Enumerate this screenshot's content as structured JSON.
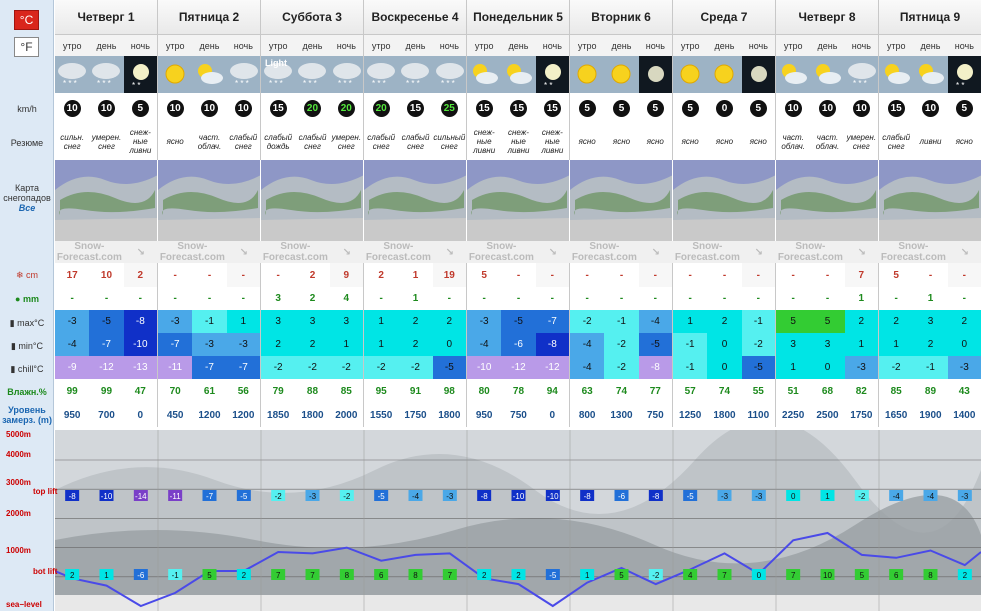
{
  "units": {
    "celsius": "°C",
    "fahrenheit": "°F"
  },
  "labels": {
    "wind": "km/h",
    "summary": "Резюме",
    "snow_map": "Карта снегопадов",
    "snow_map_all": "Все",
    "snow": "cm",
    "rain": "mm",
    "max": "max°C",
    "min": "min°C",
    "chill": "chill°C",
    "humidity": "Влажн.%",
    "freeze": "Уровень замерз. (m)",
    "alt_5000": "5000m",
    "alt_4000": "4000m",
    "alt_3000": "3000m",
    "alt_2000": "2000m",
    "alt_1000": "1000m",
    "sea_level": "sea−level",
    "top_lift": "top lift",
    "bot_lift": "bot lift",
    "logo": "Snow-Forecast.com"
  },
  "days": [
    {
      "name": "Четверг 1",
      "periods": 3
    },
    {
      "name": "Пятница 2",
      "periods": 3
    },
    {
      "name": "Суббота 3",
      "periods": 3
    },
    {
      "name": "Воскресенье 4",
      "periods": 3
    },
    {
      "name": "Понедельник 5",
      "periods": 3
    },
    {
      "name": "Вторник 6",
      "periods": 3
    },
    {
      "name": "Среда 7",
      "periods": 3
    },
    {
      "name": "Четверг 8",
      "periods": 3
    },
    {
      "name": "Пятница 9",
      "periods": 3
    }
  ],
  "periods": [
    "утро",
    "день",
    "ночь",
    "утро",
    "день",
    "ночь",
    "утро",
    "день",
    "ночь",
    "утро",
    "день",
    "ночь",
    "утро",
    "день",
    "ночь",
    "утро",
    "день",
    "ночь",
    "утро",
    "день",
    "ночь",
    "утро",
    "день",
    "ночь",
    "утро",
    "день",
    "ночь"
  ],
  "icon_caption": "Light",
  "wind": [
    "10",
    "10",
    "5",
    "10",
    "10",
    "10",
    "15",
    "20",
    "20",
    "20",
    "15",
    "25",
    "15",
    "15",
    "15",
    "5",
    "5",
    "5",
    "5",
    "0",
    "5",
    "10",
    "10",
    "10",
    "15",
    "10",
    "5"
  ],
  "wind_green": [
    false,
    false,
    false,
    false,
    false,
    false,
    false,
    true,
    true,
    true,
    false,
    true,
    false,
    false,
    false,
    false,
    false,
    false,
    false,
    false,
    false,
    false,
    false,
    false,
    false,
    false,
    false
  ],
  "summary": [
    "сильн. снег",
    "умерен. снег",
    "снеж-ные ливни",
    "ясно",
    "част. облач.",
    "слабый снег",
    "слабый дождь",
    "слабый снег",
    "умерен. снег",
    "слабый снег",
    "слабый снег",
    "сильный снег",
    "снеж-ные ливни",
    "снеж-ные ливни",
    "снеж-ные ливни",
    "ясно",
    "ясно",
    "ясно",
    "ясно",
    "ясно",
    "ясно",
    "част. облач.",
    "част. облач.",
    "умерен. снег",
    "слабый снег",
    "ливни",
    "ясно"
  ],
  "snow": [
    "17",
    "10",
    "2",
    "-",
    "-",
    "-",
    "-",
    "2",
    "9",
    "2",
    "1",
    "19",
    "5",
    "-",
    "-",
    "-",
    "-",
    "-",
    "-",
    "-",
    "-",
    "-",
    "-",
    "7",
    "5",
    "-",
    "-"
  ],
  "rain": [
    "-",
    "-",
    "-",
    "-",
    "-",
    "-",
    "3",
    "2",
    "4",
    "-",
    "1",
    "-",
    "-",
    "-",
    "-",
    "-",
    "-",
    "-",
    "-",
    "-",
    "-",
    "-",
    "-",
    "1",
    "-",
    "1",
    "-"
  ],
  "max": [
    "-3",
    "-5",
    "-8",
    "-3",
    "-1",
    "1",
    "3",
    "3",
    "3",
    "1",
    "2",
    "2",
    "-3",
    "-5",
    "-7",
    "-2",
    "-1",
    "-4",
    "1",
    "2",
    "-1",
    "5",
    "5",
    "2",
    "2",
    "3",
    "2"
  ],
  "min": [
    "-4",
    "-7",
    "-10",
    "-7",
    "-3",
    "-3",
    "2",
    "2",
    "1",
    "1",
    "2",
    "0",
    "-4",
    "-6",
    "-8",
    "-4",
    "-2",
    "-5",
    "-1",
    "0",
    "-2",
    "3",
    "3",
    "1",
    "1",
    "2",
    "0"
  ],
  "chill": [
    "-9",
    "-12",
    "-13",
    "-11",
    "-7",
    "-7",
    "-2",
    "-2",
    "-2",
    "-2",
    "-2",
    "-5",
    "-10",
    "-12",
    "-12",
    "-4",
    "-2",
    "-8",
    "-1",
    "0",
    "-5",
    "1",
    "0",
    "-3",
    "-2",
    "-1",
    "-3"
  ],
  "humidity": [
    "99",
    "99",
    "47",
    "70",
    "61",
    "56",
    "79",
    "88",
    "85",
    "95",
    "91",
    "98",
    "80",
    "78",
    "94",
    "63",
    "74",
    "77",
    "57",
    "74",
    "55",
    "51",
    "68",
    "82",
    "85",
    "89",
    "43"
  ],
  "freeze": [
    "950",
    "700",
    "0",
    "450",
    "1200",
    "1200",
    "1850",
    "1800",
    "2000",
    "1550",
    "1750",
    "1800",
    "950",
    "750",
    "0",
    "800",
    "1300",
    "750",
    "1250",
    "1800",
    "1100",
    "2250",
    "2500",
    "1750",
    "1650",
    "1900",
    "1400"
  ],
  "top_lift": [
    "-8",
    "-10",
    "-14",
    "-11",
    "-7",
    "-5",
    "-2",
    "-3",
    "-2",
    "-5",
    "-4",
    "-3",
    "-8",
    "-10",
    "-10",
    "-8",
    "-6",
    "-8",
    "-5",
    "-3",
    "-3",
    "0",
    "1",
    "-2",
    "-4",
    "-4",
    "-3"
  ],
  "bot_lift": [
    "2",
    "1",
    "-6",
    "-1",
    "5",
    "2",
    "7",
    "7",
    "8",
    "6",
    "8",
    "7",
    "2",
    "2",
    "-5",
    "1",
    "5",
    "-2",
    "4",
    "7",
    "0",
    "7",
    "10",
    "5",
    "6",
    "8",
    "2"
  ],
  "colors": {
    "accent": "#d9261c",
    "t_pos_bright": "#00e5e5",
    "t_pos_soft": "#55f0f0",
    "t_neg1": "#4aa8e8",
    "t_neg2": "#2270d8",
    "t_neg3": "#1030c8",
    "t_neg4": "#9966dd",
    "t_warm": "#33cc33",
    "freeze_line": "#4a4ae8"
  }
}
